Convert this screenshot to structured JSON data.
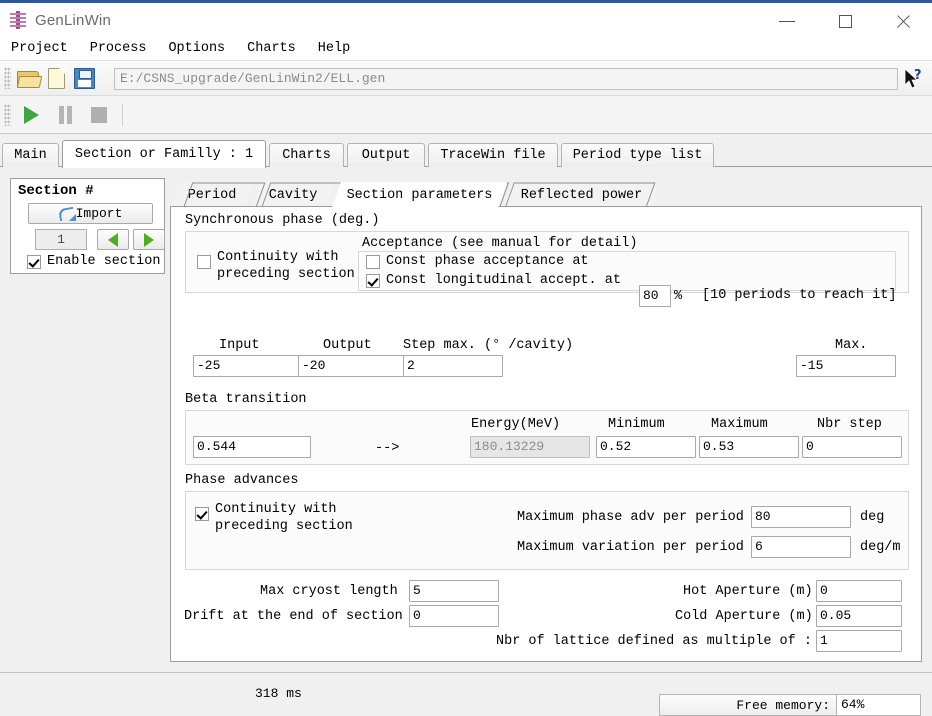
{
  "window": {
    "title": "GenLinWin",
    "icon": "app-icon",
    "controls": {
      "minimize": "minimize",
      "maximize": "maximize",
      "close": "close"
    }
  },
  "menubar": {
    "items": [
      "Project",
      "Process",
      "Options",
      "Charts",
      "Help"
    ]
  },
  "toolbar": {
    "file_buttons": [
      "open-folder-icon",
      "new-file-icon",
      "save-icon"
    ],
    "run_buttons": [
      "play-icon",
      "pause-icon",
      "stop-icon"
    ],
    "path_value": "E:/CSNS_upgrade/GenLinWin2/ELL.gen"
  },
  "main_tabs": {
    "active_index": 1,
    "items": [
      {
        "label": "Main"
      },
      {
        "label": "Section or Familly : 1"
      },
      {
        "label": "Charts"
      },
      {
        "label": "Output"
      },
      {
        "label": "TraceWin file"
      },
      {
        "label": "Period type list"
      }
    ]
  },
  "section_panel": {
    "title": "Section #",
    "import_label": "Import",
    "section_number": "1",
    "prev_label": "previous-section",
    "next_label": "next-section",
    "enable_label": "Enable section",
    "enable_checked": true
  },
  "inner_tabs": {
    "active_index": 2,
    "items": [
      {
        "label": "Period"
      },
      {
        "label": "Cavity"
      },
      {
        "label": "Section parameters"
      },
      {
        "label": "Reflected power"
      }
    ]
  },
  "synchronous_phase": {
    "group_label": "Synchronous phase (deg.)",
    "continuity_label_line1": "Continuity with",
    "continuity_label_line2": "preceding section",
    "continuity_checked": false,
    "acceptance_label": "Acceptance (see manual for detail)",
    "const_phase_label": "Const phase acceptance at",
    "const_phase_checked": false,
    "const_long_label": "Const longitudinal accept. at",
    "const_long_checked": true,
    "acceptance_value": "80",
    "acceptance_unit": "%",
    "periods_note": "[10 periods to reach it]",
    "input_label": "Input",
    "input_value": "-25",
    "output_label": "Output",
    "output_value": "-20",
    "step_max_label": "Step max. (° /cavity)",
    "step_max_value": "2",
    "max_label": "Max.",
    "max_value": "-15"
  },
  "beta_transition": {
    "group_label": "Beta transition",
    "beta_value": "0.544",
    "arrow": "-->",
    "energy_label": "Energy(MeV)",
    "energy_value": "180.13229",
    "energy_disabled": true,
    "minimum_label": "Minimum",
    "minimum_value": "0.52",
    "maximum_label": "Maximum",
    "maximum_value": "0.53",
    "nbr_step_label": "Nbr step",
    "nbr_step_value": "0"
  },
  "phase_advances": {
    "group_label": "Phase advances",
    "continuity_label_line1": "Continuity with",
    "continuity_label_line2": "preceding section",
    "continuity_checked": true,
    "max_phase_adv_label": "Maximum phase adv per period",
    "max_phase_adv_value": "80",
    "max_phase_adv_unit": "deg",
    "max_variation_label": "Maximum variation per period",
    "max_variation_value": "6",
    "max_variation_unit": "deg/m"
  },
  "bottom_fields": {
    "max_cryost_label": "Max cryost length",
    "max_cryost_value": "5",
    "drift_label": "Drift at the end of section",
    "drift_value": "0",
    "hot_aperture_label": "Hot Aperture (m)",
    "hot_aperture_value": "0",
    "cold_aperture_label": "Cold Aperture (m)",
    "cold_aperture_value": "0.05",
    "nbr_lattice_label": "Nbr of lattice defined as multiple of :",
    "nbr_lattice_value": "1"
  },
  "statusbar": {
    "time_text": "318 ms",
    "memory_label": "Free memory:",
    "memory_value": "64%"
  },
  "colors": {
    "titlebar_accent": "#2b579a",
    "green_play": "#3fa63f",
    "green_arrow": "#4caf1f",
    "panel_bg": "#f0f0f0"
  }
}
